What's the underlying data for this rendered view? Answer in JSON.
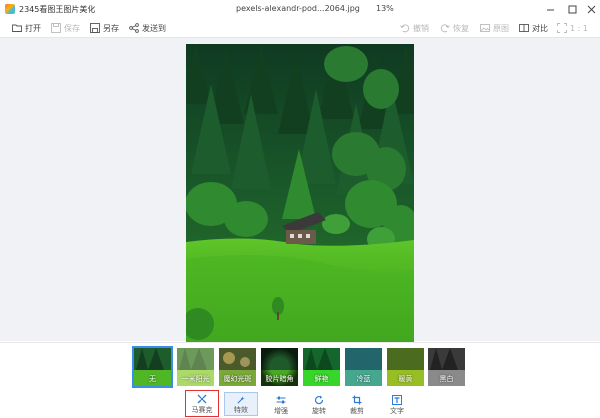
{
  "titlebar": {
    "app_name": "2345看图王图片美化",
    "file_name": "pexels-alexandr-pod...2064.jpg",
    "zoom": "13%"
  },
  "toolbar": {
    "open_label": "打开",
    "save_label": "保存",
    "save_as_label": "另存",
    "send_label": "发送到",
    "undo_label": "撤销",
    "redo_label": "恢复",
    "original_label": "原图",
    "compare_label": "对比",
    "ratio_label": "1 : 1"
  },
  "filters": [
    {
      "label": "无",
      "selected": true
    },
    {
      "label": "一米阳光",
      "selected": false
    },
    {
      "label": "魔幻光斑",
      "selected": false
    },
    {
      "label": "胶片暗角",
      "selected": false
    },
    {
      "label": "鲜艳",
      "selected": false
    },
    {
      "label": "冷蓝",
      "selected": false
    },
    {
      "label": "暖黄",
      "selected": false
    },
    {
      "label": "黑白",
      "selected": false
    }
  ],
  "bottom_tools": {
    "mosaic_label": "马赛克",
    "effects_label": "特效",
    "enhance_label": "增强",
    "rotate_label": "旋转",
    "crop_label": "裁剪",
    "text_label": "文字"
  },
  "colors": {
    "accent": "#3b8dea",
    "highlight_border": "#e23131",
    "canvas_bg": "#f0f2f5"
  }
}
